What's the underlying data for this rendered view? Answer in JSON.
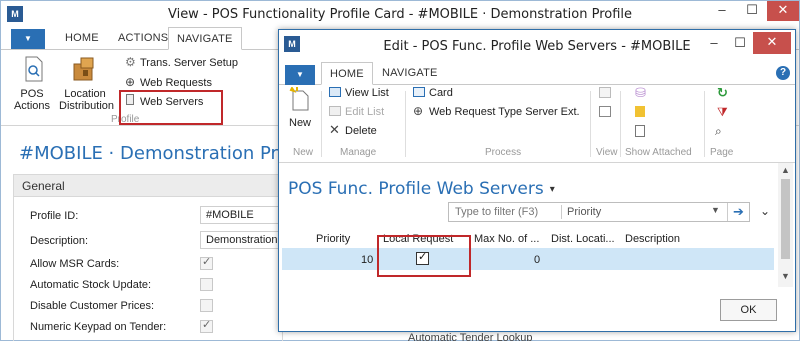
{
  "back_window": {
    "title": "View - POS Functionality Profile Card - #MOBILE · Demonstration Profile",
    "app_logo": "M",
    "tabs": [
      {
        "label": "HOME"
      },
      {
        "label": "ACTIONS"
      },
      {
        "label": "NAVIGATE",
        "active": true
      }
    ],
    "ribbon": {
      "pos_actions_label": "POS\nActions",
      "location_distribution_label": "Location\nDistribution",
      "trans_server_setup_label": "Trans. Server Setup",
      "web_requests_label": "Web Requests",
      "web_servers_label": "Web Servers",
      "group_label": "Profile"
    },
    "page_title": "#MOBILE · Demonstration Profile",
    "general": {
      "title": "General",
      "fields": [
        {
          "label": "Profile ID:",
          "value": "#MOBILE",
          "type": "text"
        },
        {
          "label": "Description:",
          "value": "Demonstration",
          "type": "text"
        },
        {
          "label": "Allow MSR Cards:",
          "checked": true,
          "type": "check"
        },
        {
          "label": "Automatic Stock Update:",
          "checked": false,
          "type": "check"
        },
        {
          "label": "Disable Customer Prices:",
          "checked": false,
          "type": "check"
        },
        {
          "label": "Numeric Keypad on Tender:",
          "checked": true,
          "type": "check"
        }
      ]
    },
    "behind_text": "Automatic Tender Lookup"
  },
  "dialog": {
    "title": "Edit - POS Func. Profile Web Servers - #MOBILE",
    "tabs": [
      {
        "label": "HOME",
        "active": true
      },
      {
        "label": "NAVIGATE"
      }
    ],
    "ribbon": {
      "new_label": "New",
      "view_list_label": "View List",
      "edit_list_label": "Edit List",
      "delete_label": "Delete",
      "card_label": "Card",
      "web_request_type_label": "Web Request Type Server Ext.",
      "show_attached_label": "Show Attached",
      "groups": {
        "new": "New",
        "manage": "Manage",
        "process": "Process",
        "view": "View",
        "show_attached": "Show Attached",
        "page": "Page"
      }
    },
    "heading": "POS Func. Profile Web Servers",
    "filter": {
      "placeholder": "Type to filter (F3)",
      "field": "Priority"
    },
    "columns": [
      "Priority",
      "Local Request",
      "Max No. of ...",
      "Dist. Locati...",
      "Description"
    ],
    "rows": [
      {
        "priority": "10",
        "local_request": true,
        "max_no": "0",
        "dist_location": "",
        "description": ""
      }
    ],
    "ok_label": "OK"
  }
}
